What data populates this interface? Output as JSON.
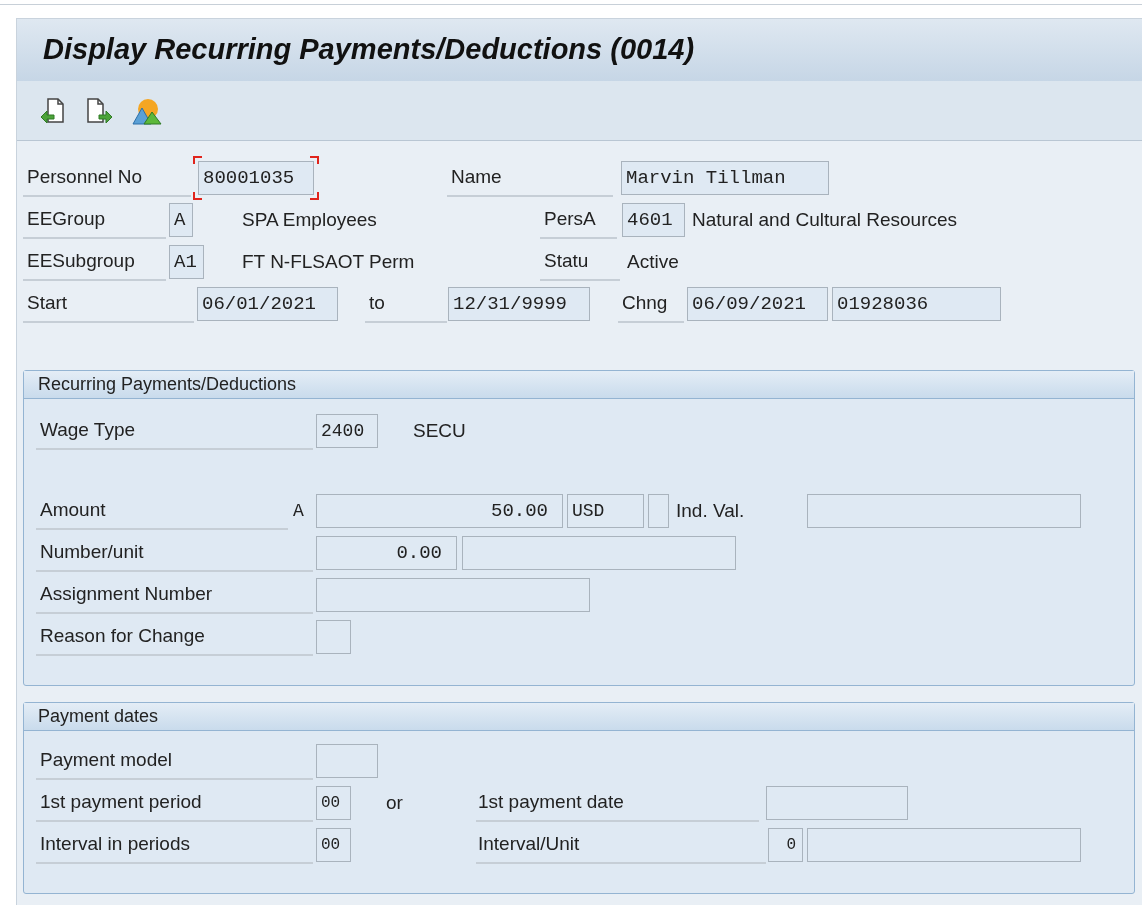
{
  "title": "Display Recurring Payments/Deductions (0014)",
  "header": {
    "personnel_no": {
      "label": "Personnel No",
      "value": "80001035",
      "focused": true
    },
    "name": {
      "label": "Name",
      "value": "Marvin Tillman"
    },
    "ee_group": {
      "label": "EEGroup",
      "value": "A",
      "text": "SPA Employees"
    },
    "pers_area": {
      "label": "PersA",
      "value": "4601",
      "text": "Natural and Cultural Resources"
    },
    "ee_subgroup": {
      "label": "EESubgroup",
      "value": "A1",
      "text": "FT N-FLSAOT Perm"
    },
    "status": {
      "label": "Statu",
      "text": "Active"
    },
    "start": {
      "label": "Start",
      "value": "06/01/2021"
    },
    "to": {
      "label": "to",
      "value": "12/31/9999"
    },
    "changed": {
      "label": "Chng",
      "date": "06/09/2021",
      "user": "01928036"
    }
  },
  "recurring": {
    "title": "Recurring Payments/Deductions",
    "wage_type": {
      "label": "Wage Type",
      "value": "2400",
      "text": "SECU"
    },
    "amount": {
      "label": "Amount",
      "indicator": "A",
      "value": "50.00",
      "currency": "USD",
      "ind_val_label": "Ind. Val."
    },
    "number_unit": {
      "label": "Number/unit",
      "value": "0.00"
    },
    "assignment_number": {
      "label": "Assignment Number"
    },
    "reason_for_change": {
      "label": "Reason for Change"
    }
  },
  "payment_dates": {
    "title": "Payment dates",
    "payment_model": {
      "label": "Payment model"
    },
    "first_payment_period": {
      "label": "1st payment period",
      "value": "00"
    },
    "or": "or",
    "first_payment_date": {
      "label": "1st payment date"
    },
    "interval_in_periods": {
      "label": "Interval in periods",
      "value": "00"
    },
    "interval_unit": {
      "label": "Interval/Unit",
      "value": "0"
    }
  }
}
